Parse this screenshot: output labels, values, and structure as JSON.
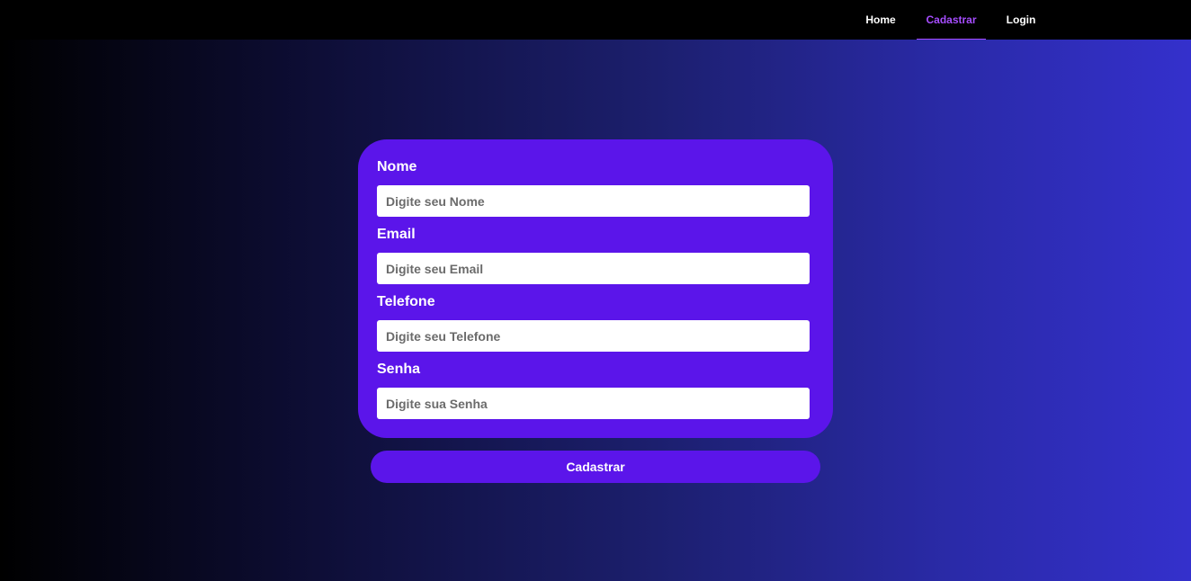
{
  "nav": {
    "items": [
      {
        "label": "Home",
        "active": false
      },
      {
        "label": "Cadastrar",
        "active": true
      },
      {
        "label": "Login",
        "active": false
      }
    ]
  },
  "form": {
    "fields": [
      {
        "label": "Nome",
        "placeholder": "Digite seu Nome",
        "value": ""
      },
      {
        "label": "Email",
        "placeholder": "Digite seu Email",
        "value": ""
      },
      {
        "label": "Telefone",
        "placeholder": "Digite seu Telefone",
        "value": ""
      },
      {
        "label": "Senha",
        "placeholder": "Digite sua Senha",
        "value": ""
      }
    ],
    "submit_label": "Cadastrar"
  },
  "colors": {
    "card": "#5b15ea",
    "nav_active": "#a64dff",
    "nav_bg": "#000000"
  }
}
